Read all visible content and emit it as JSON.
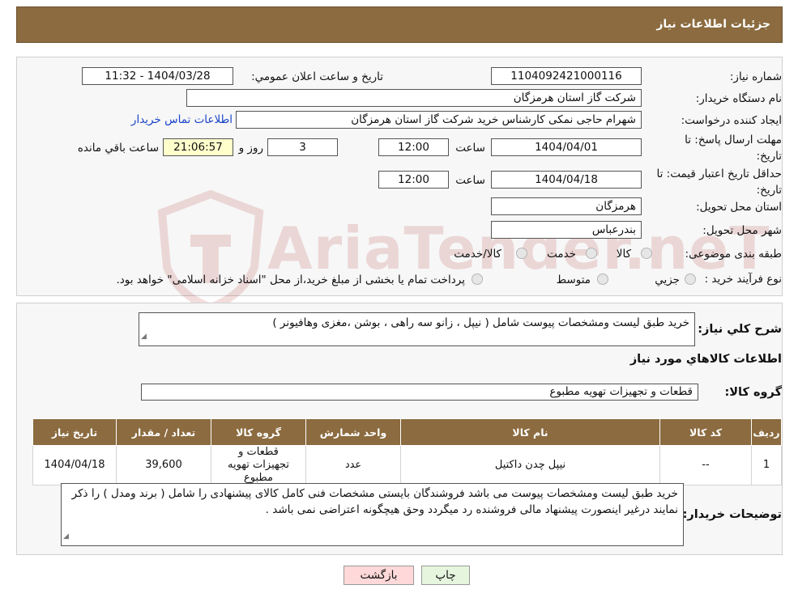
{
  "header": {
    "title": "جزئیات اطلاعات نیاز"
  },
  "watermark": {
    "text": "AriaTender.neT"
  },
  "form": {
    "need_number_label": "شماره نیاز:",
    "need_number": "1104092421000116",
    "announce_label": "تاریخ و ساعت اعلان عمومي:",
    "announce_value": "1404/03/28 - 11:32",
    "buyer_org_label": "نام دستگاه خريدار:",
    "buyer_org": "شرکت گاز استان هرمزگان",
    "creator_label": "ايجاد کننده درخواست:",
    "creator": "شهرام حاجی نمکی کارشناس خرید شرکت گاز استان هرمزگان",
    "contact_link": "اطلاعات تماس خريدار",
    "deadline_label_1": "مهلت ارسال پاسخ: تا",
    "deadline_label_2": "تاريخ:",
    "deadline_date": "1404/04/01",
    "time_label": "ساعت",
    "deadline_time": "12:00",
    "days_value": "3",
    "days_label": "روز و",
    "remaining_value": "21:06:57",
    "remaining_label": "ساعت باقي مانده",
    "validity_label_1": "حداقل تاريخ اعتبار قيمت: تا",
    "validity_label_2": "تاريخ:",
    "validity_date": "1404/04/18",
    "validity_time": "12:00",
    "province_label": "استان محل تحويل:",
    "province": "هرمزگان",
    "city_label": "شهر محل تحويل:",
    "city": "بندرعباس",
    "category_label": "طبقه بندی موضوعی:",
    "category_options": [
      "کالا",
      "خدمت",
      "کالا/خدمت"
    ],
    "process_label": "نوع فرآيند خريد :",
    "process_options": [
      "جزيي",
      "متوسط"
    ],
    "process_note": "پرداخت تمام یا بخشی از مبلغ خرید،از محل \"اسناد خزانه اسلامی\" خواهد بود."
  },
  "summary": {
    "desc_label": "شرح كلي نياز:",
    "desc": "خرید طبق لیست ومشخصات پیوست شامل ( نیپل ، زانو سه راهی ، بوشن ،مغزی وهافیونر )",
    "items_title": "اطلاعات کالاهاي مورد نياز",
    "group_label": "گروه کالا:",
    "group_value": "قطعات و تجهیزات تهویه مطبوع"
  },
  "table": {
    "headers": [
      "رديف",
      "کد کالا",
      "نام کالا",
      "واحد شمارش",
      "گروه کالا",
      "تعداد / مقدار",
      "تاريخ نياز"
    ],
    "rows": [
      [
        "1",
        "--",
        "نیپل چدن داکتیل",
        "عدد",
        "قطعات و تجهیزات تهویه مطبوع",
        "39,600",
        "1404/04/18"
      ]
    ]
  },
  "buyer_notes": {
    "label": "توضيحات خريدار:",
    "text": "خرید طبق لیست ومشخصات پیوست می باشد فروشندگان بایستی مشخصات فنی کامل کالای پیشنهادی را شامل ( برند ومدل ) را ذکر نمایند درغیر اینصورت پیشنهاد مالی فروشنده رد میگردد وحق هیچگونه اعتراضی نمی باشد ."
  },
  "buttons": {
    "print": "چاپ",
    "back": "بازگشت"
  },
  "colors": {
    "header_bg": "#8b6b3f",
    "link": "#1a44c8",
    "back_bg": "#ffd9d9",
    "print_bg": "#e6f5de"
  }
}
